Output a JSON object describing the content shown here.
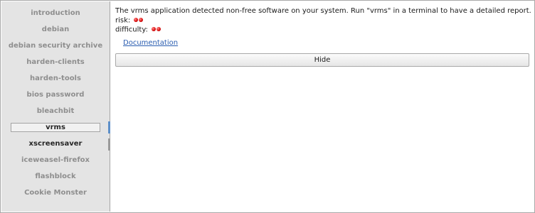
{
  "sidebar": {
    "items": [
      {
        "label": "introduction"
      },
      {
        "label": "debian"
      },
      {
        "label": "debian security archive"
      },
      {
        "label": "harden-clients"
      },
      {
        "label": "harden-tools"
      },
      {
        "label": "bios password"
      },
      {
        "label": "bleachbit"
      },
      {
        "label": "vrms",
        "active": true
      },
      {
        "label": "xscreensaver"
      },
      {
        "label": "iceweasel-firefox"
      },
      {
        "label": "flashblock"
      },
      {
        "label": "Cookie Monster"
      }
    ]
  },
  "main": {
    "description": "The vrms application detected non-free software on your system. Run \"vrms\" in a terminal to have a detailed report.",
    "risk_label": "risk:",
    "risk_level": 2,
    "difficulty_label": "difficulty:",
    "difficulty_level": 2,
    "documentation_link": "Documentation",
    "hide_button": "Hide"
  },
  "colors": {
    "sidebar_bg": "#e4e4e4",
    "active_marker": "#5d8fc9",
    "link": "#2a5db0",
    "indicator_red": "#d11111"
  },
  "icons": {
    "risk": "red-dot-icon",
    "difficulty": "red-dot-icon"
  }
}
